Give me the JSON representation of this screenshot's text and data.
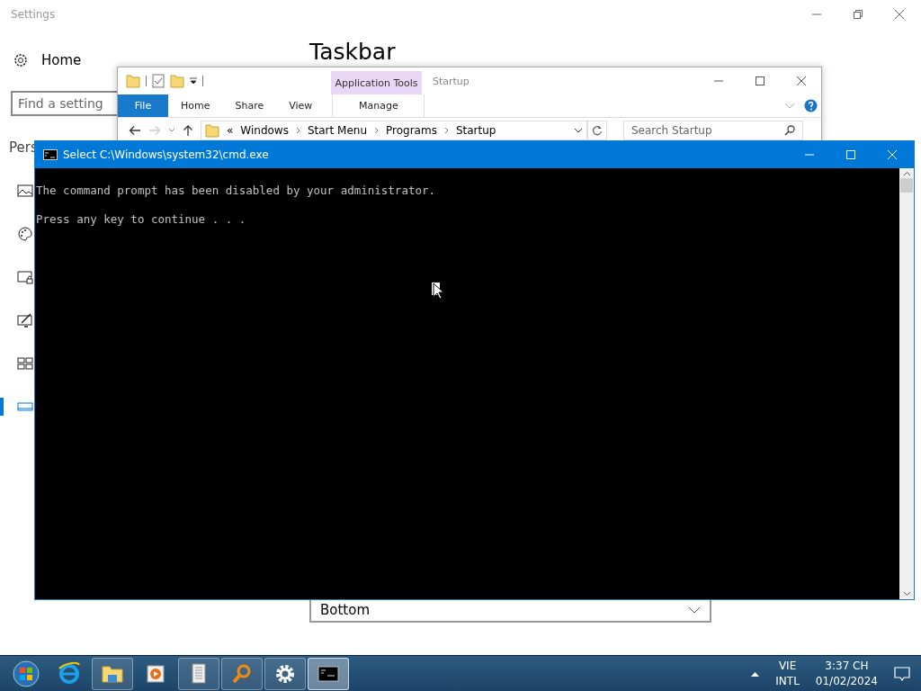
{
  "settings": {
    "title": "Settings",
    "home": "Home",
    "search": {
      "placeholder": "Find a setting"
    },
    "section": "Pers",
    "heading": "Taskbar",
    "sidebar": {
      "items": [
        {
          "kind": "background",
          "selected": false
        },
        {
          "kind": "colors",
          "selected": false
        },
        {
          "kind": "lockscreen",
          "selected": false
        },
        {
          "kind": "themes",
          "selected": false
        },
        {
          "kind": "start",
          "selected": false
        },
        {
          "kind": "taskbar",
          "selected": true
        }
      ]
    },
    "dropdown": {
      "value": "Bottom"
    }
  },
  "explorer": {
    "context_tab": "Application Tools",
    "title": "Startup",
    "tabs": [
      {
        "label": "File",
        "kind": "file"
      },
      {
        "label": "Home",
        "kind": "normal"
      },
      {
        "label": "Share",
        "kind": "normal"
      },
      {
        "label": "View",
        "kind": "normal"
      },
      {
        "label": "Manage",
        "kind": "context"
      }
    ],
    "address": {
      "prefix": "«",
      "crumbs": [
        "Windows",
        "Start Menu",
        "Programs",
        "Startup"
      ]
    },
    "search": {
      "placeholder": "Search Startup"
    }
  },
  "cmd": {
    "title": "Select C:\\Windows\\system32\\cmd.exe",
    "lines": [
      "The command prompt has been disabled by your administrator.",
      "Press any key to continue . . ."
    ]
  },
  "taskbar": {
    "apps": [
      {
        "kind": "start",
        "running": false,
        "selected": false
      },
      {
        "kind": "browser",
        "running": false,
        "selected": false
      },
      {
        "kind": "explorer",
        "running": true,
        "selected": false
      },
      {
        "kind": "media",
        "running": false,
        "selected": false
      },
      {
        "kind": "document",
        "running": true,
        "selected": false
      },
      {
        "kind": "search",
        "running": true,
        "selected": false
      },
      {
        "kind": "settings",
        "running": true,
        "selected": false
      },
      {
        "kind": "terminal",
        "running": true,
        "selected": true
      }
    ],
    "tray": {
      "language": "VIE",
      "layout": "INTL",
      "time": "3:37 CH",
      "date": "01/02/2024"
    }
  }
}
